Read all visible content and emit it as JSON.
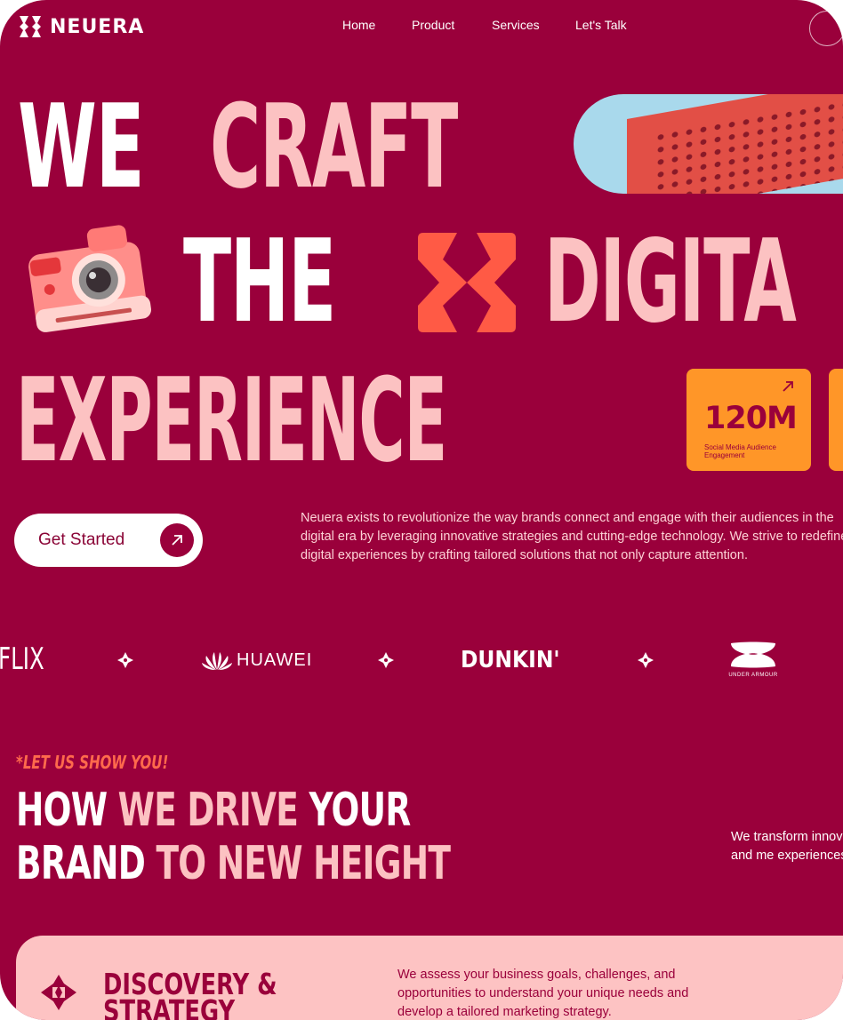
{
  "brand": {
    "name": "NEUERA"
  },
  "nav": {
    "items": [
      "Home",
      "Product",
      "Services",
      "Let's Talk"
    ]
  },
  "hero": {
    "line1_a": "WE",
    "line1_b": "CRAFT",
    "line2_a": "THE",
    "line2_b": "DIGITA",
    "line3": "EXPERIENCE",
    "stat": {
      "value": "120M",
      "label": "Social Media Audience Engagement"
    },
    "cta_label": "Get Started",
    "description": "Neuera exists to revolutionize the way brands connect and engage with their audiences in the digital era by leveraging innovative strategies and cutting-edge technology. We strive to redefine digital experiences by crafting tailored solutions that not only capture attention."
  },
  "brands": [
    "FLIX",
    "HUAWEI",
    "DUNKIN'",
    "UNDER ARMOUR"
  ],
  "section": {
    "tagline": "*LET US SHOW YOU!",
    "heading_l1_a": "HOW",
    "heading_l1_b": "WE DRIVE",
    "heading_l1_c": "YOUR",
    "heading_l2_a": "BRAND",
    "heading_l2_b": "TO NEW HEIGHT",
    "side_description": "We transform innov captivating and me experiences that er"
  },
  "service_card": {
    "title_l1": "DISCOVERY &",
    "title_l2": "STRATEGY",
    "description": "We assess your business goals, challenges, and opportunities to understand your unique needs and develop a tailored marketing strategy."
  },
  "colors": {
    "background": "#9a003b",
    "pink": "#fcc2c2",
    "coral": "#ff5a45",
    "orange": "#ff9628",
    "white": "#ffffff"
  },
  "icons": [
    "neuera-logo-icon",
    "camera-icon",
    "neuera-mark-icon",
    "arrow-up-right-icon",
    "diamond-separator-icon",
    "huawei-logo-icon",
    "under-armour-logo-icon",
    "service-mark-icon"
  ]
}
